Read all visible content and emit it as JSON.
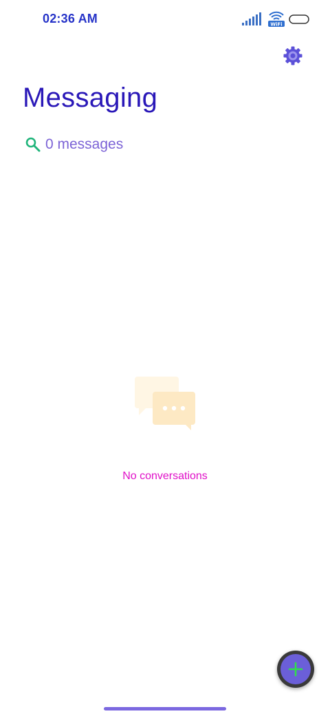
{
  "status_bar": {
    "time": "02:36 AM",
    "wifi_label": "WiFi",
    "icons": [
      "signal-icon",
      "wifi-icon",
      "battery-icon"
    ]
  },
  "header": {
    "settings_icon": "gear-icon",
    "title": "Messaging"
  },
  "search": {
    "icon": "search-icon",
    "label": "0 messages"
  },
  "empty_state": {
    "icon": "chat-bubbles-icon",
    "text": "No conversations"
  },
  "fab": {
    "icon": "plus-icon"
  },
  "colors": {
    "time": "#2633c8",
    "title": "#2a18b8",
    "search_icon": "#1fb47a",
    "search_label": "#7c63d6",
    "empty_text": "#e010c8",
    "fab_ring": "#3a3a3a",
    "fab_fill": "#6b5fd9",
    "fab_plus": "#2fe04a",
    "gear": "#5b50d8",
    "home_indicator": "#7b68e0"
  }
}
